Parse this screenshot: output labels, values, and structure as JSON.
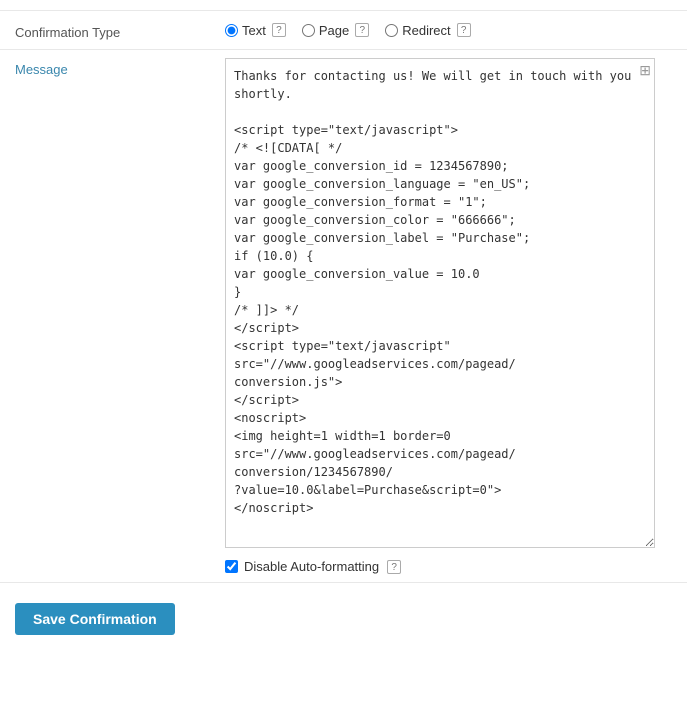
{
  "form": {
    "confirmation_type_label": "Confirmation Type",
    "message_label": "Message",
    "radio_options": [
      {
        "id": "radio-text",
        "label": "Text",
        "checked": true
      },
      {
        "id": "radio-page",
        "label": "Page",
        "checked": false
      },
      {
        "id": "radio-redirect",
        "label": "Redirect",
        "checked": false
      }
    ],
    "message_content": "Thanks for contacting us! We will get in touch with you shortly.",
    "disable_autoformatting_label": "Disable Auto-formatting",
    "save_button_label": "Save Confirmation"
  }
}
